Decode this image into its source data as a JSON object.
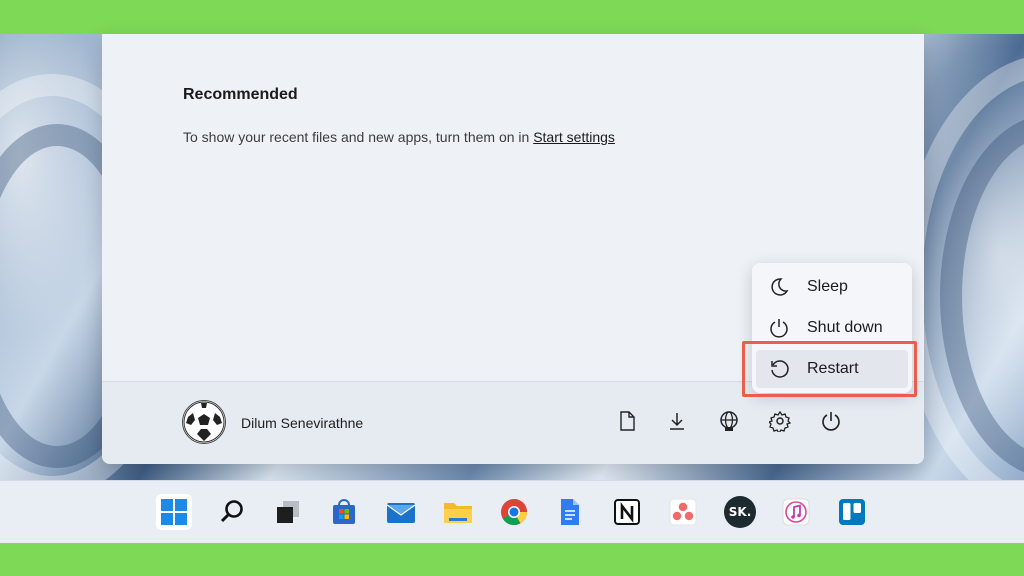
{
  "start_menu": {
    "recommended_title": "Recommended",
    "recommended_desc": "To show your recent files and new apps, turn them on in",
    "start_settings_link": "Start settings",
    "user_name": "Dilum Senevirathne"
  },
  "footer_icons": [
    "document-icon",
    "downloads-icon",
    "network-globe-icon",
    "settings-gear-icon",
    "power-icon"
  ],
  "power_menu": {
    "items": [
      {
        "label": "Sleep",
        "icon": "moon-icon"
      },
      {
        "label": "Shut down",
        "icon": "power-icon"
      },
      {
        "label": "Restart",
        "icon": "restart-icon",
        "highlighted": true
      }
    ],
    "highlight_color": "#e8604c"
  },
  "taskbar": {
    "apps": [
      "windows-start-icon",
      "search-icon",
      "task-view-icon",
      "microsoft-store-icon",
      "mail-icon",
      "file-explorer-icon",
      "chrome-icon",
      "google-docs-icon",
      "notion-icon",
      "asana-icon",
      "sk-app-icon",
      "itunes-icon",
      "trello-icon"
    ],
    "sk_label": "SK."
  },
  "colors": {
    "frame_green": "#7ed957",
    "menu_bg": "#eef2f7"
  }
}
